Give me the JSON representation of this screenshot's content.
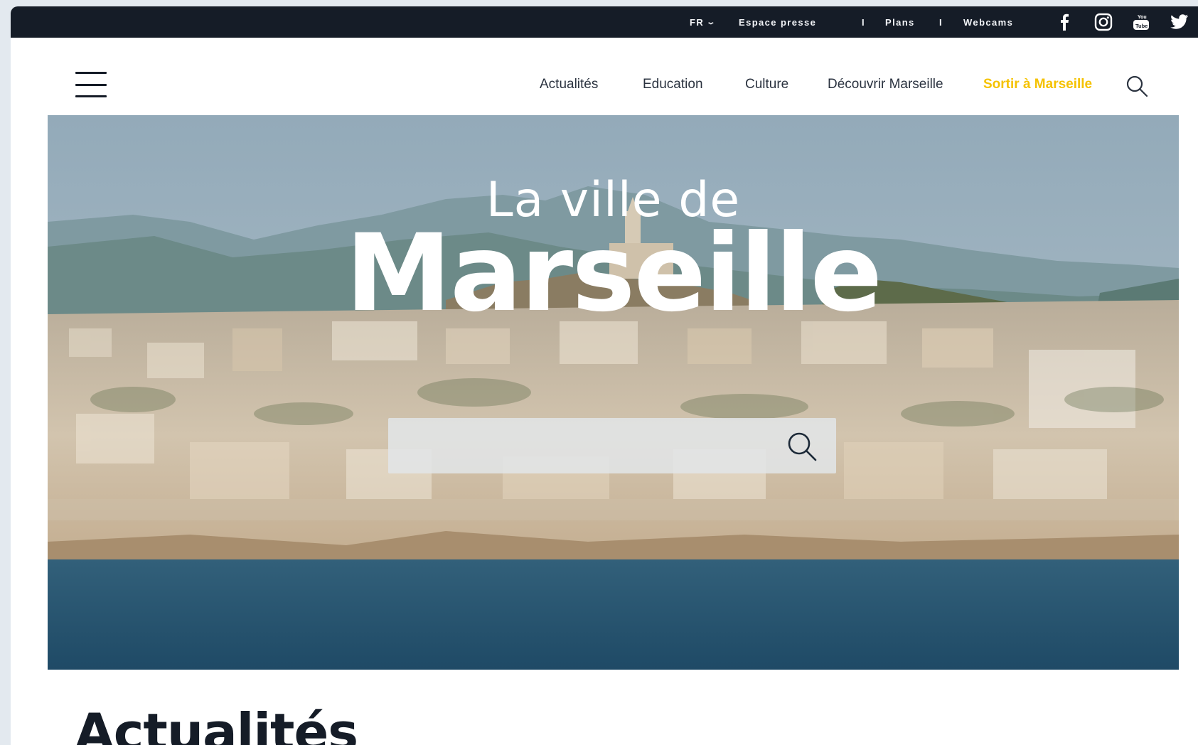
{
  "topbar": {
    "language": "FR",
    "links": [
      "Espace presse",
      "Plans",
      "Webcams"
    ],
    "separator": "I",
    "social": [
      "facebook-icon",
      "instagram-icon",
      "youtube-icon",
      "twitter-icon"
    ]
  },
  "nav": {
    "items": [
      "Actualités",
      "Education",
      "Culture",
      "Découvrir Marseille",
      "Sortir à Marseille"
    ],
    "highlight_color": "#f5c200"
  },
  "hero": {
    "title_line1": "La ville de",
    "title_line2": "Marseille",
    "search_placeholder": ""
  },
  "section": {
    "title": "Actualités"
  },
  "colors": {
    "topbar_bg": "#151c27",
    "accent": "#f5c200",
    "text": "#2b3340"
  }
}
